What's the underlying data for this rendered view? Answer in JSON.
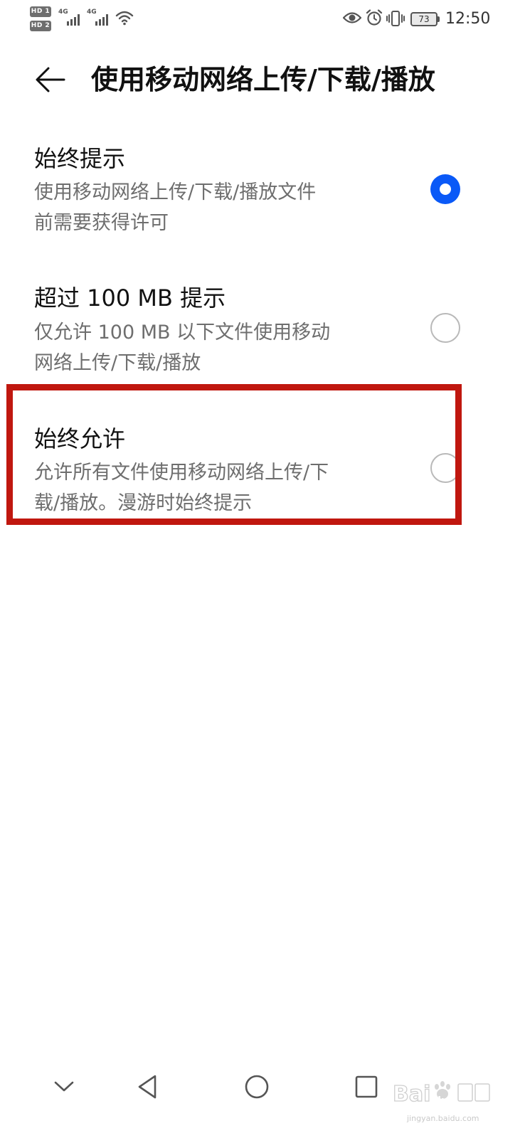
{
  "status_bar": {
    "sim1_badge": "HD 1",
    "sim2_badge": "HD 2",
    "sim1_network": "4G",
    "sim2_network": "4G",
    "battery_level": "73",
    "time": "12:50"
  },
  "header": {
    "title": "使用移动网络上传/下载/播放"
  },
  "options": [
    {
      "title": "始终提示",
      "description": "使用移动网络上传/下载/播放文件\n前需要获得许可",
      "selected": true
    },
    {
      "title": "超过 100 MB 提示",
      "description": "仅允许 100 MB 以下文件使用移动\n网络上传/下载/播放",
      "selected": false
    },
    {
      "title": "始终允许",
      "description": "允许所有文件使用移动网络上传/下\n载/播放。漫游时始终提示",
      "selected": false
    }
  ],
  "colors": {
    "accent": "#0a59f7",
    "highlight": "#c0170f",
    "description_text": "#6e6e6e"
  },
  "icons": {
    "back": "arrow-left-icon",
    "nav": [
      "chevron-down-icon",
      "triangle-back-icon",
      "circle-home-icon",
      "square-recent-icon"
    ]
  },
  "watermark": {
    "url": "jingyan.baidu.com"
  }
}
